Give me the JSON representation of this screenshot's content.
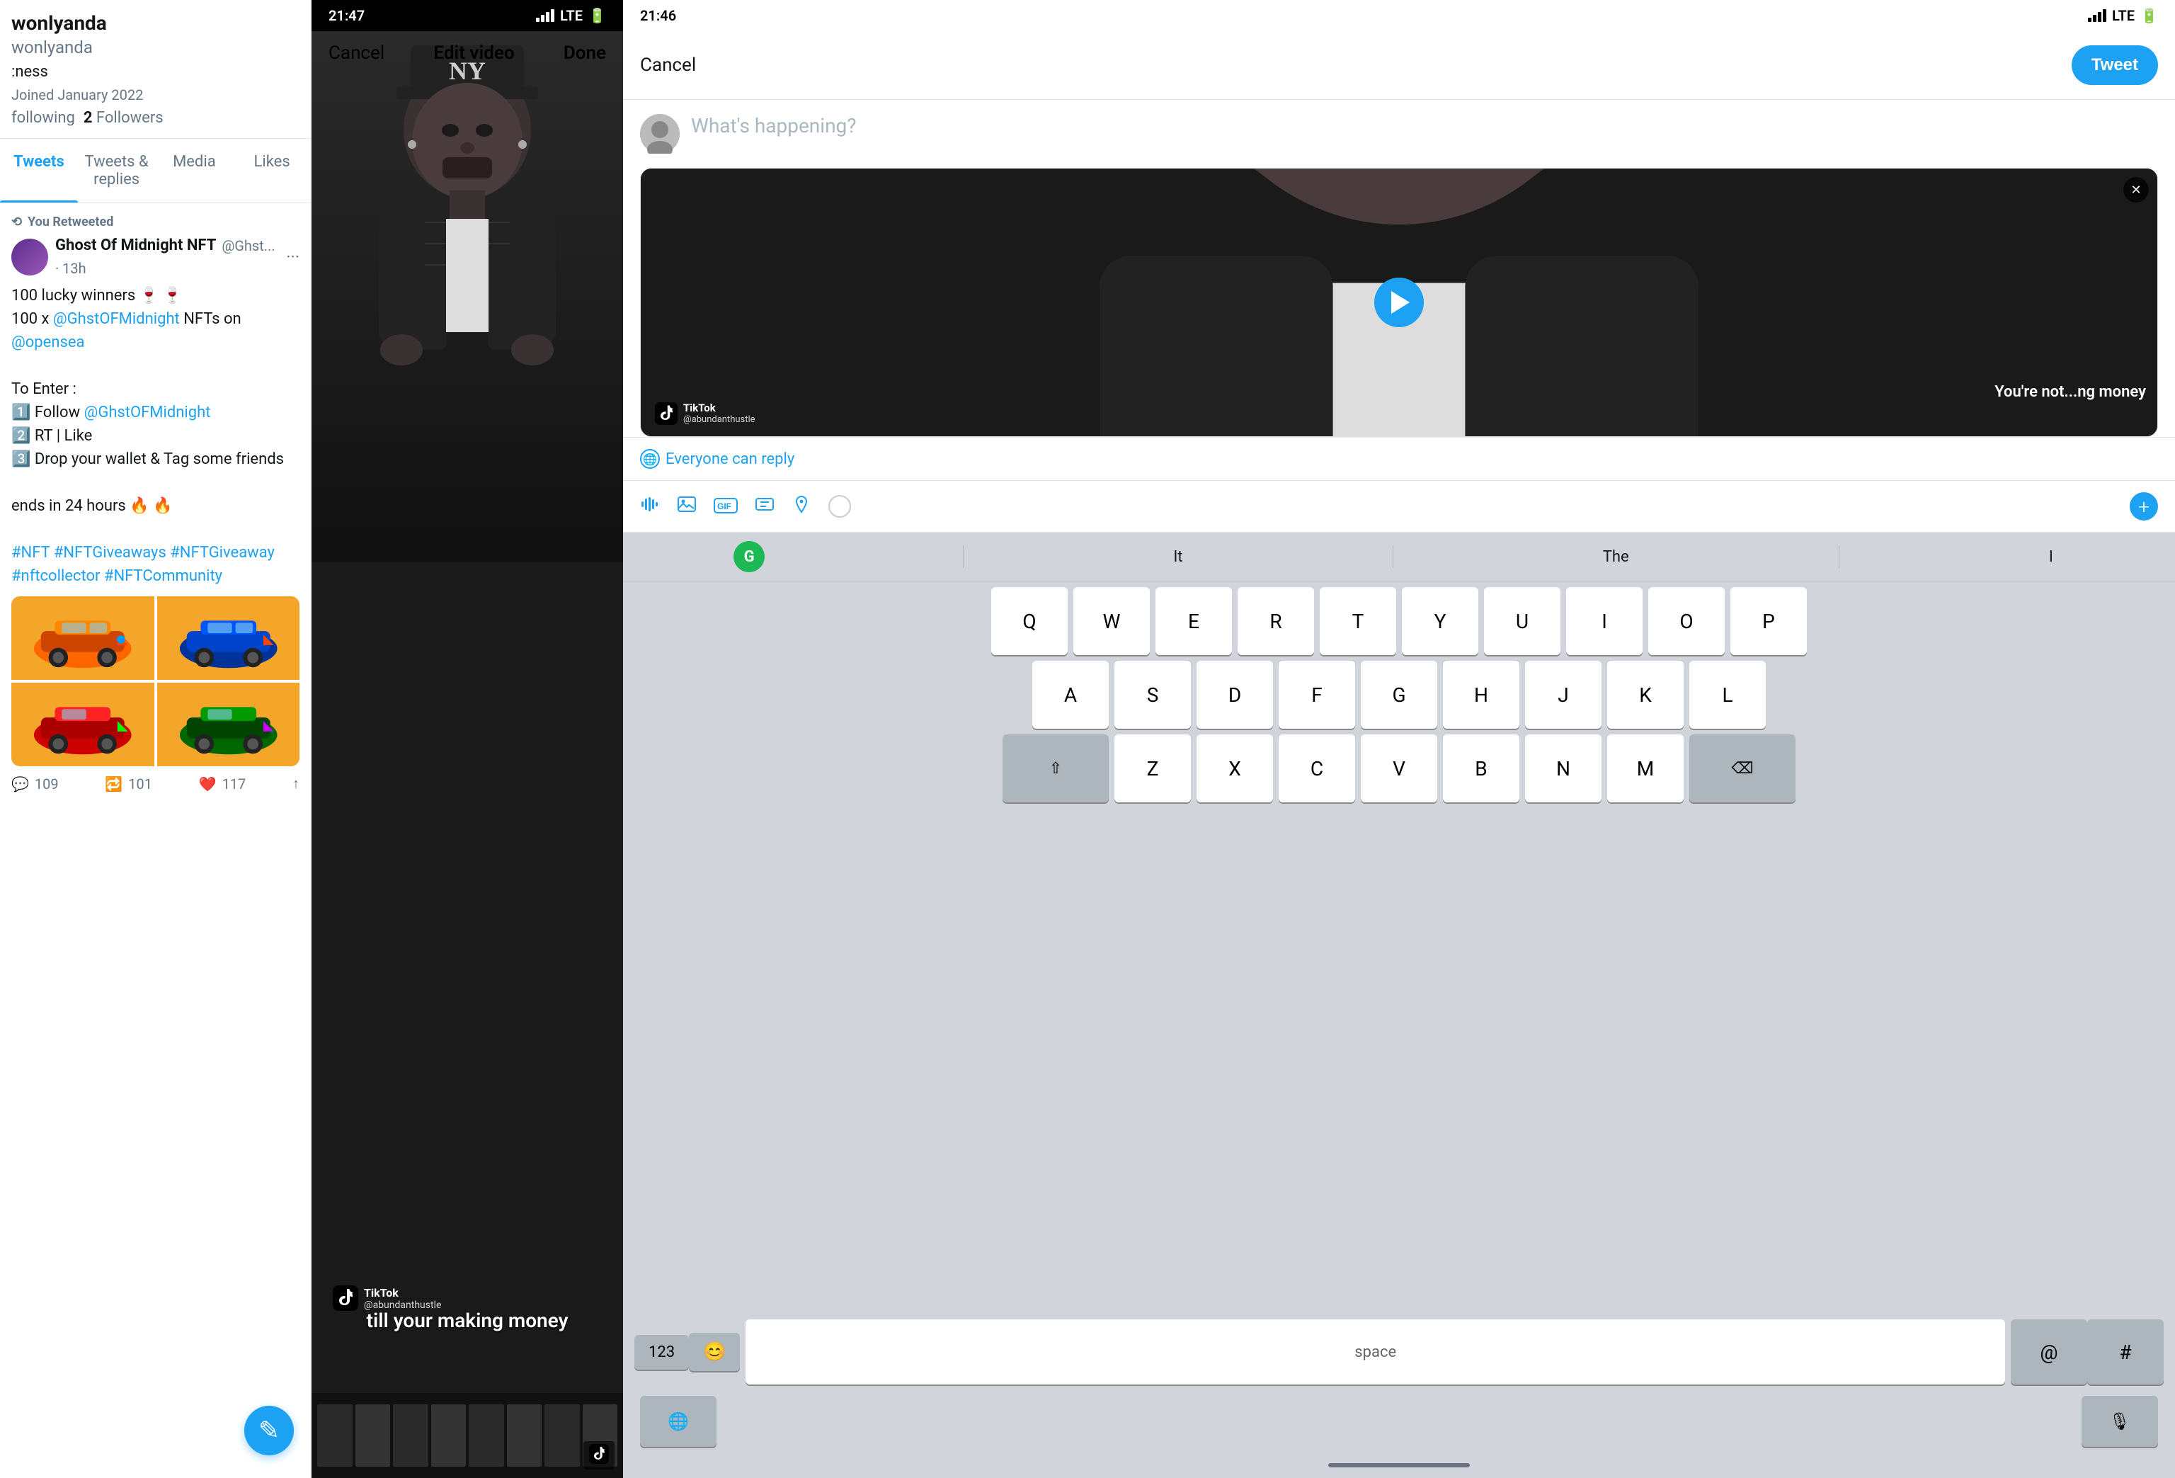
{
  "left_panel": {
    "username": "wonlyanda",
    "bio": ":ness",
    "joined": "Joined January 2022",
    "following_label": "following",
    "followers_count": "2",
    "followers_label": "Followers",
    "tabs": [
      {
        "id": "tweets",
        "label": "Tweets",
        "active": true
      },
      {
        "id": "tweets-replies",
        "label": "Tweets & replies",
        "active": false
      },
      {
        "id": "media",
        "label": "Media",
        "active": false
      },
      {
        "id": "likes",
        "label": "Likes",
        "active": false
      }
    ],
    "tweet": {
      "retweet_label": "You Retweeted",
      "author_name": "Ghost Of Midnight NFT",
      "author_handle": "@Ghst...",
      "time": "· 13h",
      "more": "···",
      "lines": [
        "100 lucky winners 🍷 🍷",
        "100 x @GhstOFMidnight NFTs on @opensea",
        "",
        "To Enter :",
        "1️⃣ Follow @GhstOFMidnight",
        "2️⃣ RT | Like",
        "3️⃣ Drop your wallet & Tag some friends",
        "",
        "ends in 24 hours 🔥 🔥",
        "",
        "#NFT #NFTGiveaways #NFTGiveaway #nftcollector #NFTCommunity"
      ],
      "reply_count": "109",
      "retweet_count": "101",
      "like_count": "117"
    }
  },
  "middle_panel": {
    "status_time": "21:47",
    "header_cancel": "Cancel",
    "header_title": "Edit video",
    "header_done": "Done",
    "caption": "till your making money",
    "tiktok_handle": "@abundanthustle"
  },
  "right_panel": {
    "status_time": "21:46",
    "compose_cancel": "Cancel",
    "tweet_button": "Tweet",
    "placeholder": "What's happening?",
    "reply_setting": "Everyone can reply",
    "preview_caption": "You're not...ng money",
    "tiktok_handle": "@abundanthustle",
    "keyboard": {
      "suggestions": [
        "It",
        "The",
        "I"
      ],
      "row1": [
        "Q",
        "W",
        "E",
        "R",
        "T",
        "Y",
        "U",
        "I",
        "O",
        "P"
      ],
      "row2": [
        "A",
        "S",
        "D",
        "F",
        "G",
        "H",
        "J",
        "K",
        "L"
      ],
      "row3": [
        "Z",
        "X",
        "C",
        "V",
        "B",
        "N",
        "M"
      ],
      "bottom_left": "123",
      "bottom_emoji": "😊",
      "spacebar": "space",
      "bottom_at": "@",
      "bottom_hash": "#",
      "bottom_delete": "⌫",
      "globe": "🌐",
      "mic": "🎙"
    }
  }
}
